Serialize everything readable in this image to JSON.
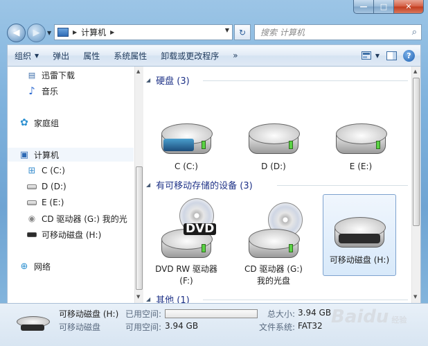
{
  "window": {
    "minimize": "—",
    "maximize": "□",
    "close": "✕"
  },
  "nav": {
    "back": "◀",
    "forward": "▶",
    "history": "▼"
  },
  "address": {
    "path": "计算机",
    "sep1": "▶",
    "sep2": "▶",
    "dropdown": "▼",
    "refresh": "↻"
  },
  "search": {
    "placeholder": "搜索 计算机",
    "icon": "⌕"
  },
  "toolbar": {
    "items": [
      {
        "label": "组织",
        "caret": "▼"
      },
      {
        "label": "弹出"
      },
      {
        "label": "属性"
      },
      {
        "label": "系统属性"
      },
      {
        "label": "卸载或更改程序"
      },
      {
        "label": "»"
      }
    ],
    "view_caret": "▼",
    "help": "?"
  },
  "sidebar": {
    "items": [
      {
        "label": "迅雷下载",
        "icon": "document-icon"
      },
      {
        "label": "音乐",
        "icon": "music-icon"
      },
      {
        "label": "家庭组",
        "icon": "homegroup-icon"
      },
      {
        "label": "计算机",
        "icon": "computer-icon"
      },
      {
        "label": "C (C:)",
        "icon": "windows-drive-icon"
      },
      {
        "label": "D (D:)",
        "icon": "drive-icon"
      },
      {
        "label": "E (E:)",
        "icon": "drive-icon"
      },
      {
        "label": "CD 驱动器 (G:) 我的光",
        "icon": "cd-drive-icon"
      },
      {
        "label": "可移动磁盘 (H:)",
        "icon": "removable-drive-icon"
      },
      {
        "label": "网络",
        "icon": "network-icon"
      }
    ],
    "glyphs": {
      "document": "▤",
      "music": "♪",
      "homegroup": "✿",
      "computer": "▣",
      "network": "⊕",
      "disc": "◉",
      "windows": "⊞"
    }
  },
  "groups": {
    "hdd": {
      "title": "硬盘 (3)",
      "toggle": "◢",
      "items": [
        "C (C:)",
        "D (D:)",
        "E (E:)"
      ]
    },
    "removable": {
      "title": "有可移动存储的设备 (3)",
      "toggle": "◢",
      "items": [
        {
          "line1": "DVD RW 驱动器",
          "line2": "(F:)",
          "badge": "DVD"
        },
        {
          "line1": "CD 驱动器 (G:)",
          "line2": "我的光盘"
        },
        {
          "line1": "可移动磁盘 (H:)"
        }
      ]
    },
    "other": {
      "title": "其他 (1)",
      "toggle": "◢"
    }
  },
  "scroll": {
    "up": "▲",
    "down": "▼"
  },
  "details": {
    "name": "可移动磁盘 (H:)",
    "type": "可移动磁盘",
    "used_label": "已用空间:",
    "free_label": "可用空间:",
    "free_value": "3.94 GB",
    "total_label": "总大小:",
    "total_value": "3.94 GB",
    "fs_label": "文件系统:",
    "fs_value": "FAT32",
    "used_fraction": 0.0
  },
  "watermark": {
    "text": "Baidu",
    "sub": "经验"
  },
  "colors": {
    "accent": "#1e3287",
    "frame": "#7fb2dd",
    "selection": "#d8e9fa"
  }
}
